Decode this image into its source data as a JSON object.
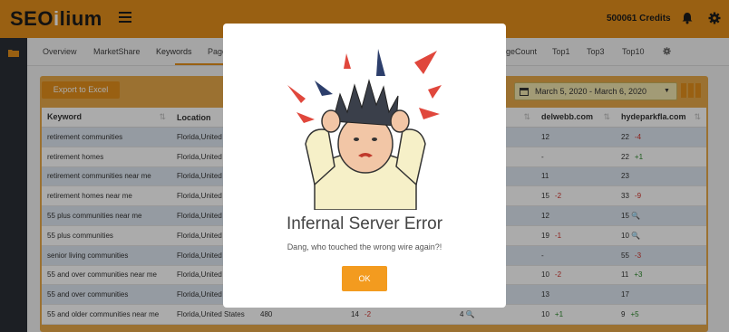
{
  "header": {
    "logo_text_a": "SEO",
    "logo_text_b": "i",
    "logo_text_c": "lium",
    "credits": "500061 Credits",
    "accent_color": "#e5901b"
  },
  "tabs": [
    {
      "label": "Overview"
    },
    {
      "label": "MarketShare"
    },
    {
      "label": "Keywords"
    },
    {
      "label": "Page"
    },
    {
      "label": "geCount"
    },
    {
      "label": "Top1"
    },
    {
      "label": "Top3"
    },
    {
      "label": "Top10"
    }
  ],
  "toolbar": {
    "export_label": "Export to Excel",
    "date_range": "March 5, 2020 - March 6, 2020"
  },
  "table": {
    "columns": [
      "Keyword",
      "Location",
      "delwebb.com",
      "hydeparkfla.com"
    ],
    "rows": [
      {
        "keyword": "retirement communities",
        "location": "Florida,United",
        "volume": "",
        "c1": "",
        "c2": "",
        "delwebb": "12",
        "delwebb_delta": "",
        "hyde": "22",
        "hyde_delta": "-4"
      },
      {
        "keyword": "retirement homes",
        "location": "Florida,United",
        "volume": "",
        "c1": "",
        "c2": "",
        "delwebb": "-",
        "delwebb_delta": "",
        "hyde": "22",
        "hyde_delta": "+1"
      },
      {
        "keyword": "retirement communities near me",
        "location": "Florida,United",
        "volume": "",
        "c1": "",
        "c2": "",
        "delwebb": "11",
        "delwebb_delta": "",
        "hyde": "23",
        "hyde_delta": ""
      },
      {
        "keyword": "retirement homes near me",
        "location": "Florida,United",
        "volume": "",
        "c1": "",
        "c2": "",
        "delwebb": "15",
        "delwebb_delta": "-2",
        "hyde": "33",
        "hyde_delta": "-9"
      },
      {
        "keyword": "55 plus communities near me",
        "location": "Florida,United",
        "volume": "",
        "c1": "",
        "c2": "",
        "delwebb": "12",
        "delwebb_delta": "",
        "hyde": "15",
        "hyde_delta": ""
      },
      {
        "keyword": "55 plus communities",
        "location": "Florida,United",
        "volume": "",
        "c1": "",
        "c2": "",
        "delwebb": "19",
        "delwebb_delta": "-1",
        "hyde": "10",
        "hyde_delta": ""
      },
      {
        "keyword": "senior living communities",
        "location": "Florida,United",
        "volume": "",
        "c1": "",
        "c2": "",
        "delwebb": "-",
        "delwebb_delta": "",
        "hyde": "55",
        "hyde_delta": "-3"
      },
      {
        "keyword": "55 and over communities near me",
        "location": "Florida,United",
        "volume": "",
        "c1": "",
        "c2": "",
        "delwebb": "10",
        "delwebb_delta": "-2",
        "hyde": "11",
        "hyde_delta": "+3"
      },
      {
        "keyword": "55 and over communities",
        "location": "Florida,United",
        "volume": "",
        "c1": "",
        "c2": "",
        "delwebb": "13",
        "delwebb_delta": "",
        "hyde": "17",
        "hyde_delta": ""
      },
      {
        "keyword": "55 and older communities near me",
        "location": "Florida,United States",
        "volume": "480",
        "c1": "14",
        "c1_delta": "-2",
        "c2": "4",
        "delwebb": "10",
        "delwebb_delta": "+1",
        "hyde": "9",
        "hyde_delta": "+5"
      }
    ]
  },
  "modal": {
    "title": "Infernal Server Error",
    "message": "Dang, who touched the wrong wire again?!",
    "ok_label": "OK"
  }
}
